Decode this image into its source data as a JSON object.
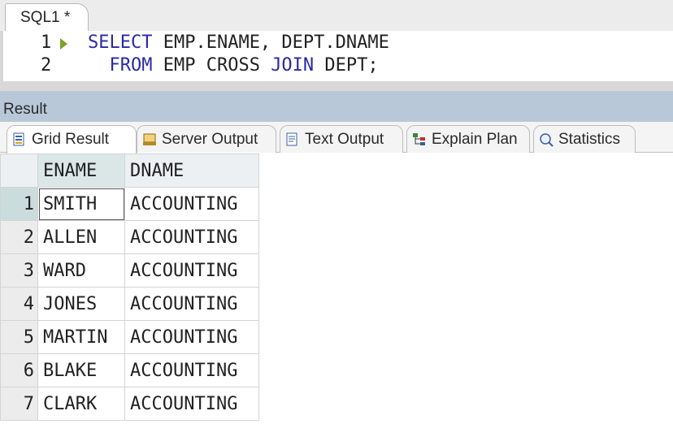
{
  "editor_tab": {
    "title": "SQL1 *"
  },
  "editor": {
    "lines": [
      {
        "num": "1",
        "kw1": "SELECT",
        "text1": " EMP.ENAME, DEPT.DNAME"
      },
      {
        "num": "2",
        "indent": "  ",
        "kw1": "FROM",
        "text1": " EMP CROSS ",
        "kw2": "JOIN",
        "text2": " DEPT;"
      }
    ]
  },
  "result": {
    "title": "Result",
    "tabs": [
      {
        "label": "Grid Result",
        "icon": "grid-icon",
        "active": true
      },
      {
        "label": "Server Output",
        "icon": "server-output-icon"
      },
      {
        "label": "Text Output",
        "icon": "text-output-icon"
      },
      {
        "label": "Explain Plan",
        "icon": "explain-plan-icon"
      },
      {
        "label": "Statistics",
        "icon": "statistics-icon"
      }
    ],
    "columns": [
      "ENAME",
      "DNAME"
    ],
    "rows": [
      {
        "n": "1",
        "ename": "SMITH",
        "dname": "ACCOUNTING"
      },
      {
        "n": "2",
        "ename": "ALLEN",
        "dname": "ACCOUNTING"
      },
      {
        "n": "3",
        "ename": "WARD",
        "dname": "ACCOUNTING"
      },
      {
        "n": "4",
        "ename": "JONES",
        "dname": "ACCOUNTING"
      },
      {
        "n": "5",
        "ename": "MARTIN",
        "dname": "ACCOUNTING"
      },
      {
        "n": "6",
        "ename": "BLAKE",
        "dname": "ACCOUNTING"
      },
      {
        "n": "7",
        "ename": "CLARK",
        "dname": "ACCOUNTING"
      }
    ]
  },
  "colors": {
    "keyword": "#2a2aa6",
    "result_header_bg": "#b8c8d8",
    "run_arrow": "#7aa32a"
  }
}
